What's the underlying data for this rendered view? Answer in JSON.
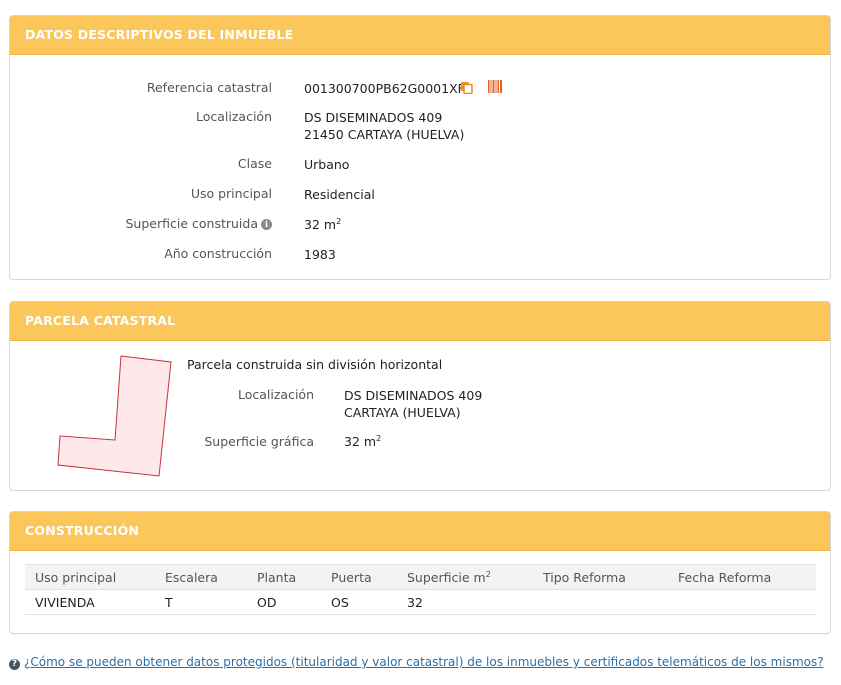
{
  "inmueble": {
    "header": "DATOS DESCRIPTIVOS DEL INMUEBLE",
    "referencia_label": "Referencia catastral",
    "referencia_value": "001300700PB62G0001XF",
    "localizacion_label": "Localización",
    "localizacion_line1": "DS DISEMINADOS 409",
    "localizacion_line2": "21450 CARTAYA (HUELVA)",
    "clase_label": "Clase",
    "clase_value": "Urbano",
    "uso_label": "Uso principal",
    "uso_value": "Residencial",
    "superficie_label": "Superficie construida",
    "superficie_value": "32 m",
    "superficie_exp": "2",
    "anio_label": "Año construcción",
    "anio_value": "1983"
  },
  "parcela": {
    "header": "PARCELA CATASTRAL",
    "title": "Parcela construida sin división horizontal",
    "localizacion_label": "Localización",
    "localizacion_line1": "DS DISEMINADOS 409",
    "localizacion_line2": "CARTAYA (HUELVA)",
    "superficie_label": "Superficie gráfica",
    "superficie_value": "32 m",
    "superficie_exp": "2"
  },
  "construccion": {
    "header": "CONSTRUCCIÓN",
    "columns": [
      "Uso principal",
      "Escalera",
      "Planta",
      "Puerta",
      "Superficie m",
      "Tipo Reforma",
      "Fecha Reforma"
    ],
    "superficie_exp": "2",
    "rows": [
      [
        "VIVIENDA",
        "T",
        "OD",
        "OS",
        "32",
        "",
        ""
      ]
    ]
  },
  "footer": {
    "link_text": "¿Cómo se pueden obtener datos protegidos (titularidad y valor catastral) de los inmuebles y certificados telemáticos de los mismos?"
  },
  "colors": {
    "header_bg": "#fbc65a",
    "parcel_fill": "#fde8ea",
    "parcel_stroke": "#c8313f",
    "link": "#2a6fa8"
  }
}
